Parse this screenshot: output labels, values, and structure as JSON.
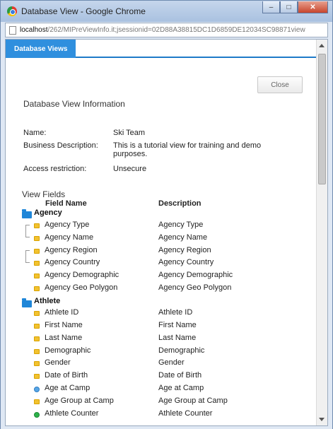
{
  "window": {
    "title": "Database View - Google Chrome",
    "minimize_glyph": "–",
    "maximize_glyph": "□",
    "close_glyph": "✕"
  },
  "address": {
    "host": "localhost",
    "path": "/262/MIPreViewInfo.it;jsessionid=02D88A38815DC1D6859DE12034SC98871view"
  },
  "tabs": [
    {
      "label": "Database Views"
    }
  ],
  "close_button": "Close",
  "info_title": "Database View Information",
  "info": [
    {
      "label": "Name:",
      "value": "Ski Team"
    },
    {
      "label": "Business Description:",
      "value": "This is a tutorial view for training and demo purposes."
    },
    {
      "label": "Access restriction:",
      "value": "Unsecure"
    }
  ],
  "fields_title": "View Fields",
  "columns": {
    "field_name": "Field Name",
    "description": "Description"
  },
  "groups": [
    {
      "name": "Agency",
      "fields": [
        {
          "name": "Agency Type",
          "description": "Agency Type",
          "icon": "attribute-icon"
        },
        {
          "name": "Agency Name",
          "description": "Agency Name",
          "icon": "attribute-icon"
        },
        {
          "name": "Agency Region",
          "description": "Agency Region",
          "icon": "attribute-icon"
        },
        {
          "name": "Agency Country",
          "description": "Agency Country",
          "icon": "attribute-icon"
        },
        {
          "name": "Agency Demographic",
          "description": "Agency Demographic",
          "icon": "attribute-icon"
        },
        {
          "name": "Agency Geo Polygon",
          "description": "Agency Geo Polygon",
          "icon": "attribute-icon"
        }
      ]
    },
    {
      "name": "Athlete",
      "fields": [
        {
          "name": "Athlete ID",
          "description": "Athlete ID",
          "icon": "attribute-icon"
        },
        {
          "name": "First Name",
          "description": "First Name",
          "icon": "attribute-icon"
        },
        {
          "name": "Last Name",
          "description": "Last Name",
          "icon": "attribute-icon"
        },
        {
          "name": "Demographic",
          "description": "Demographic",
          "icon": "attribute-icon"
        },
        {
          "name": "Gender",
          "description": "Gender",
          "icon": "attribute-icon"
        },
        {
          "name": "Date of Birth",
          "description": "Date of Birth",
          "icon": "attribute-icon"
        },
        {
          "name": "Age at Camp",
          "description": "Age at Camp",
          "icon": "metric-icon"
        },
        {
          "name": "Age Group at Camp",
          "description": "Age Group at Camp",
          "icon": "attribute-icon"
        },
        {
          "name": "Athlete Counter",
          "description": "Athlete Counter",
          "icon": "counter-icon"
        }
      ]
    }
  ]
}
